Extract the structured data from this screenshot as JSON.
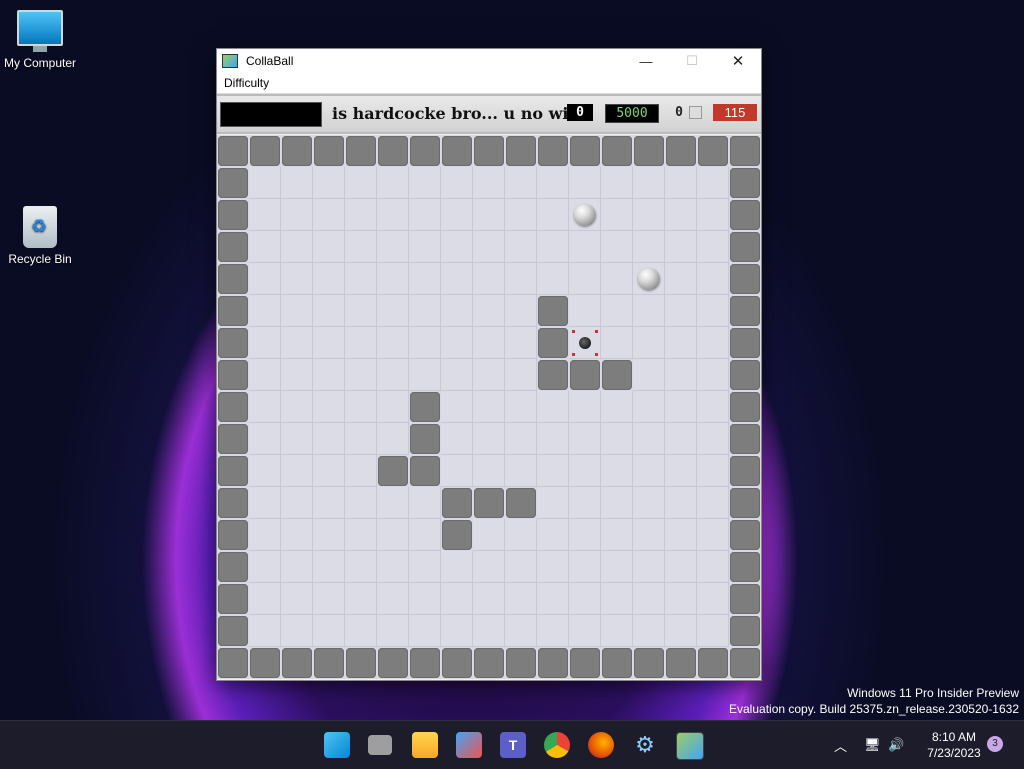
{
  "desktop": {
    "icons": [
      {
        "label": "My Computer"
      },
      {
        "label": "Recycle Bin"
      }
    ]
  },
  "window": {
    "title": "CollaBall",
    "menu": [
      "Difficulty"
    ],
    "hud": {
      "message": "is hardcocke bro... u no win",
      "lives": "0",
      "target_score": "5000",
      "count": "0",
      "timer": "115"
    }
  },
  "board": {
    "grid_size": 17,
    "inner_walls": [
      [
        10,
        5
      ],
      [
        10,
        6
      ],
      [
        10,
        7
      ],
      [
        11,
        7
      ],
      [
        12,
        7
      ],
      [
        6,
        8
      ],
      [
        6,
        9
      ],
      [
        5,
        10
      ],
      [
        6,
        10
      ],
      [
        7,
        11
      ],
      [
        8,
        11
      ],
      [
        9,
        11
      ],
      [
        7,
        12
      ]
    ],
    "balls": [
      [
        11,
        2
      ],
      [
        13,
        4
      ]
    ],
    "hole": [
      11,
      6
    ]
  },
  "watermark": {
    "line1": "Windows 11 Pro Insider Preview",
    "line2": "Evaluation copy. Build 25375.zn_release.230520-1632"
  },
  "taskbar": {
    "time": "8:10 AM",
    "date": "7/23/2023",
    "notifications": "3"
  },
  "colors": {
    "wall": "#7d7d7d",
    "timer_bg": "#c0392b",
    "target_text": "#7cd86b"
  }
}
